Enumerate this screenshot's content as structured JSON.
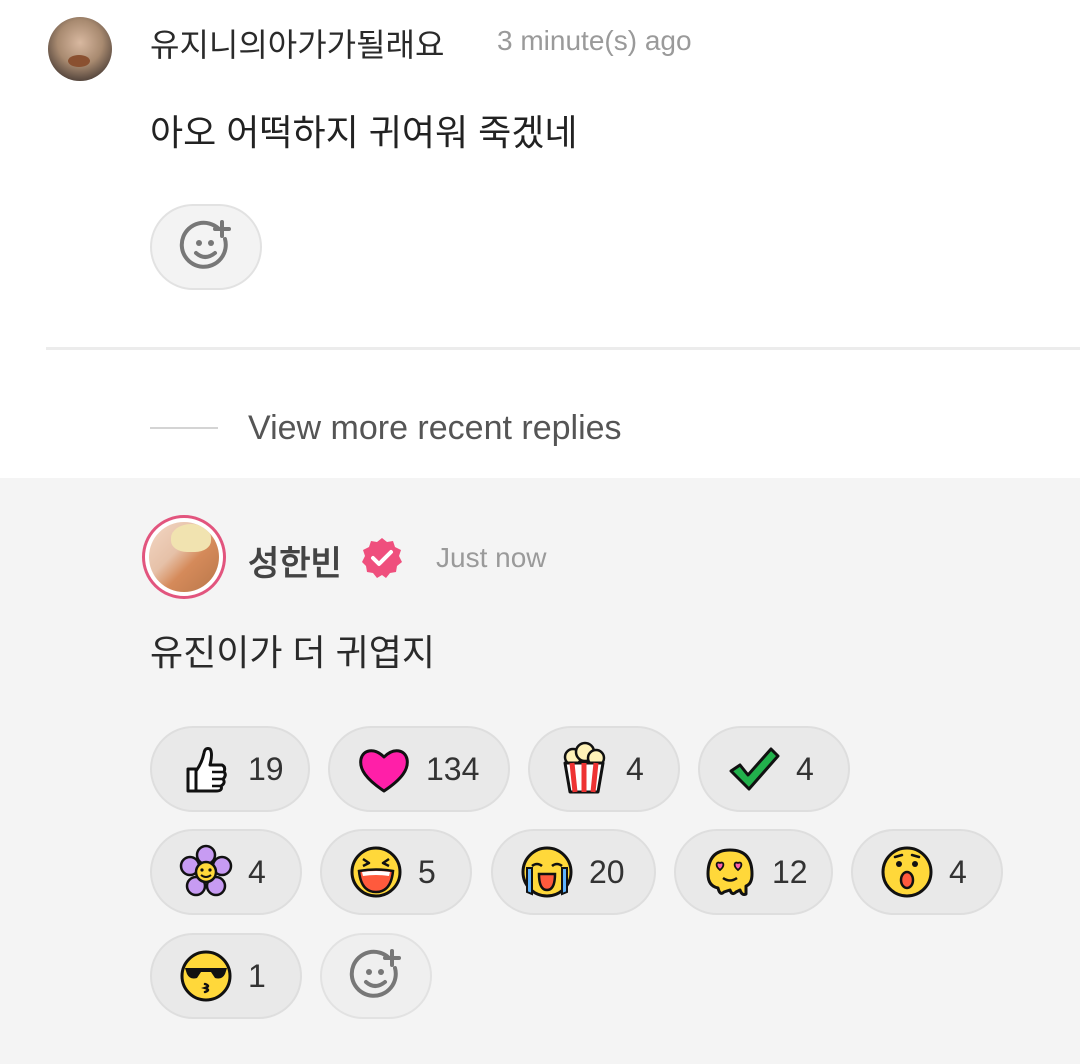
{
  "comment": {
    "author": "유지니의아가가될래요",
    "time": "3 minute(s) ago",
    "body": "아오 어떡하지 귀여워 죽겠네",
    "avatar_icon": "user-avatar-photo",
    "add_reaction_icon": "add-reaction-icon"
  },
  "view_more": {
    "label": "View more recent replies"
  },
  "reply": {
    "author": "성한빈",
    "verified_icon": "verified-badge-icon",
    "time": "Just now",
    "body": "유진이가 더 귀엽지",
    "reactions": [
      {
        "icon": "thumbs-up-icon",
        "count": "19"
      },
      {
        "icon": "heart-icon",
        "count": "134"
      },
      {
        "icon": "popcorn-icon",
        "count": "4"
      },
      {
        "icon": "check-icon",
        "count": "4"
      },
      {
        "icon": "flower-icon",
        "count": "4"
      },
      {
        "icon": "laughing-face-icon",
        "count": "5"
      },
      {
        "icon": "crying-face-icon",
        "count": "20"
      },
      {
        "icon": "melting-heart-eyes-icon",
        "count": "12"
      },
      {
        "icon": "surprised-face-icon",
        "count": "4"
      },
      {
        "icon": "sunglasses-kiss-face-icon",
        "count": "1"
      }
    ],
    "add_reaction_icon": "add-reaction-icon"
  },
  "colors": {
    "accent_pink": "#e2557e",
    "pill_bg": "#e9e9e9",
    "reply_bg": "#f4f4f4",
    "muted_text": "#9a9a9a"
  }
}
